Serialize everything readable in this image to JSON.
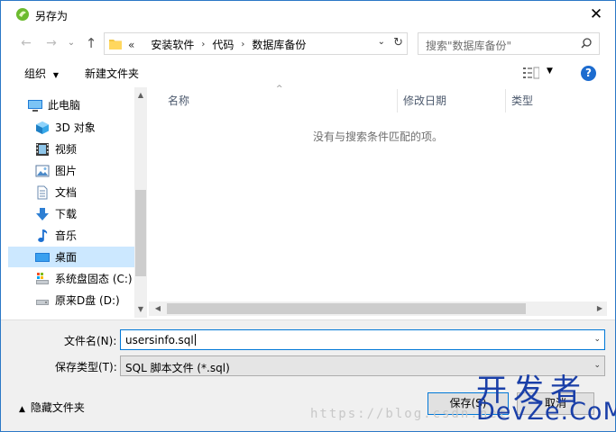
{
  "window": {
    "title": "另存为",
    "close_glyph": "✕"
  },
  "nav": {
    "back": "←",
    "forward": "→",
    "dropdown": "⌄",
    "up": "↑"
  },
  "address": {
    "overflow": "«",
    "crumbs": [
      "安装软件",
      "代码",
      "数据库备份"
    ],
    "sep": "›",
    "dropdown": "⌄",
    "refresh": "↻"
  },
  "search": {
    "placeholder": "搜索\"数据库备份\""
  },
  "toolbar": {
    "organize": "组织",
    "organize_caret": "▼",
    "new_folder": "新建文件夹",
    "view_caret": "▼",
    "help": "?"
  },
  "sidebar": {
    "items": [
      {
        "label": "此电脑",
        "icon": "computer-icon"
      },
      {
        "label": "3D 对象",
        "icon": "3d-objects-icon"
      },
      {
        "label": "视频",
        "icon": "video-icon"
      },
      {
        "label": "图片",
        "icon": "pictures-icon"
      },
      {
        "label": "文档",
        "icon": "documents-icon"
      },
      {
        "label": "下载",
        "icon": "download-icon"
      },
      {
        "label": "音乐",
        "icon": "music-icon"
      },
      {
        "label": "桌面",
        "icon": "desktop-icon",
        "selected": true
      },
      {
        "label": "系统盘固态 (C:)",
        "icon": "system-drive-icon"
      },
      {
        "label": "原来D盘 (D:)",
        "icon": "drive-icon"
      }
    ]
  },
  "columns": {
    "name": "名称",
    "modified": "修改日期",
    "type": "类型",
    "sort_caret": "^"
  },
  "content": {
    "empty_message": "没有与搜索条件匹配的项。"
  },
  "scroll": {
    "up": "▲",
    "down": "▼",
    "left": "◀",
    "right": "▶"
  },
  "form": {
    "filename_label": "文件名(N):",
    "filename_value": "usersinfo.sql",
    "filetype_label": "保存类型(T):",
    "filetype_value": "SQL 脚本文件 (*.sql)",
    "dropdown": "⌄",
    "hide_folders": "隐藏文件夹",
    "hide_caret": "▲",
    "save": "保存(S)",
    "cancel": "取消"
  },
  "watermark": {
    "cn": "开发者",
    "en": "DevZe.CoM",
    "url": "https://blog.csdn.net"
  },
  "colors": {
    "accent": "#0078d7",
    "selected_bg": "#cce8ff",
    "help": "#1d6ccf",
    "watermark": "#1a3fa8"
  }
}
